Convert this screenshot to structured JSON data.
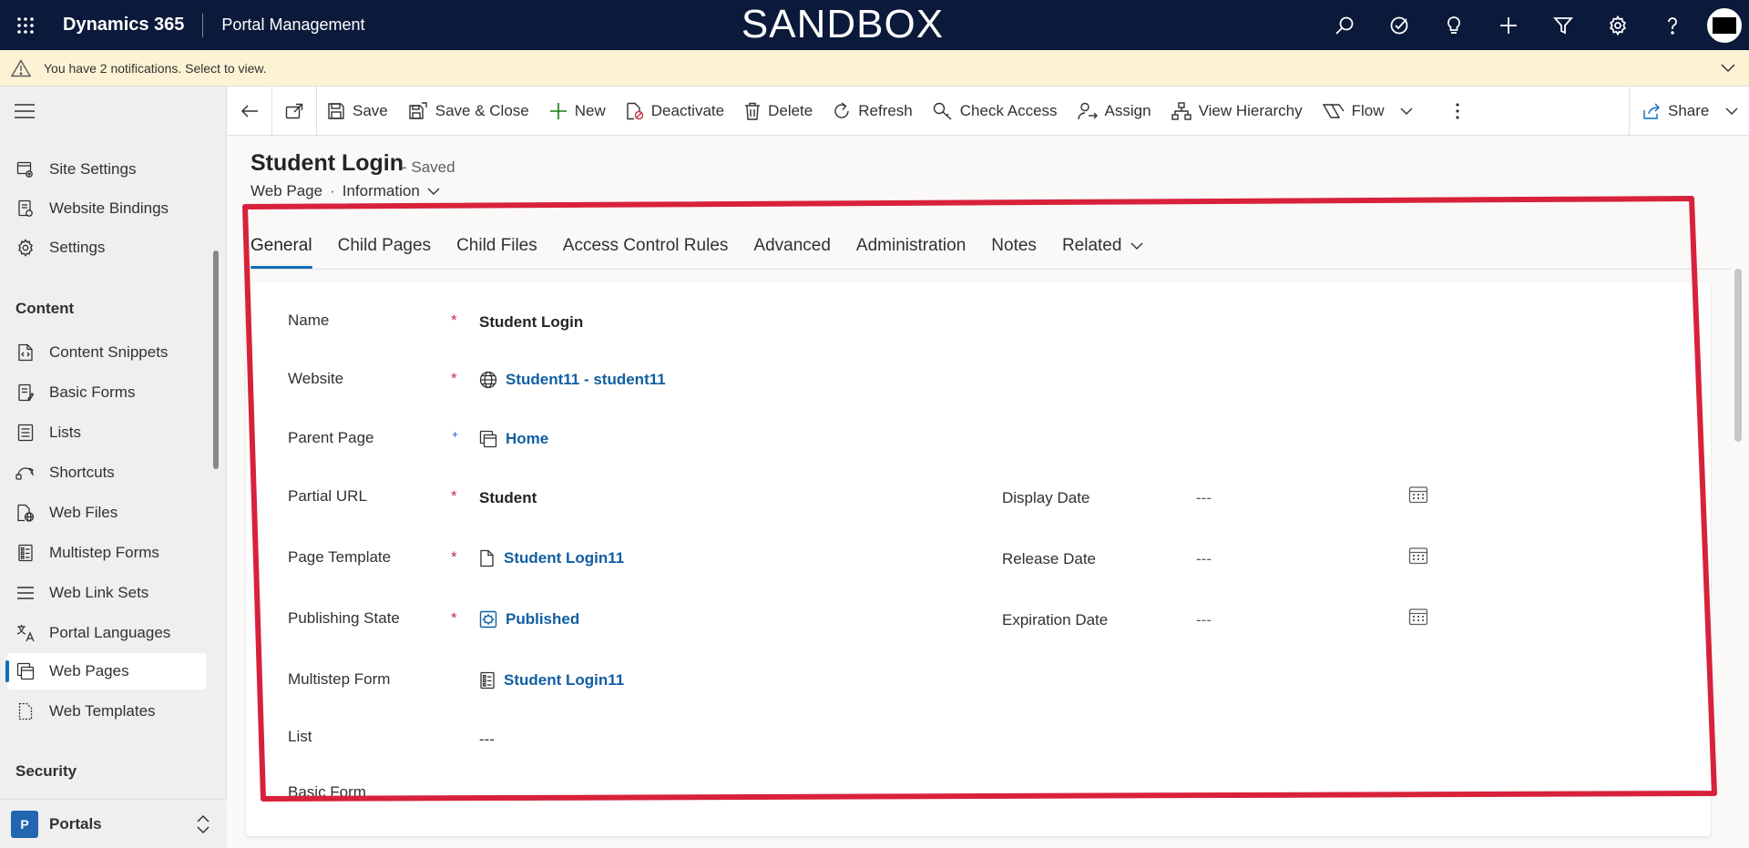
{
  "topbar": {
    "app_name": "Dynamics 365",
    "module_name": "Portal Management",
    "environment_label": "SANDBOX",
    "icons": [
      "search-icon",
      "task-check-icon",
      "lightbulb-icon",
      "plus-icon",
      "filter-icon",
      "gear-icon",
      "help-icon",
      "avatar"
    ]
  },
  "notification": {
    "text": "You have 2 notifications. Select to view."
  },
  "sidebar": {
    "items_top": [
      {
        "label": "Site Settings",
        "icon": "site-settings-icon"
      },
      {
        "label": "Website Bindings",
        "icon": "website-bindings-icon"
      },
      {
        "label": "Settings",
        "icon": "gear-icon"
      }
    ],
    "content_group": "Content",
    "content_items": [
      {
        "label": "Content Snippets",
        "icon": "snippet-icon"
      },
      {
        "label": "Basic Forms",
        "icon": "form-icon"
      },
      {
        "label": "Lists",
        "icon": "list-icon"
      },
      {
        "label": "Shortcuts",
        "icon": "shortcut-icon"
      },
      {
        "label": "Web Files",
        "icon": "web-file-icon"
      },
      {
        "label": "Multistep Forms",
        "icon": "multistep-form-icon"
      },
      {
        "label": "Web Link Sets",
        "icon": "link-set-icon"
      },
      {
        "label": "Portal Languages",
        "icon": "language-icon"
      },
      {
        "label": "Web Pages",
        "icon": "web-page-icon",
        "active": true
      },
      {
        "label": "Web Templates",
        "icon": "template-icon"
      }
    ],
    "security_group": "Security",
    "area": {
      "badge": "P",
      "name": "Portals"
    }
  },
  "commandbar": {
    "save": "Save",
    "save_close": "Save & Close",
    "new": "New",
    "deactivate": "Deactivate",
    "delete": "Delete",
    "refresh": "Refresh",
    "check_access": "Check Access",
    "assign": "Assign",
    "view_hierarchy": "View Hierarchy",
    "flow": "Flow",
    "share": "Share"
  },
  "record": {
    "title": "Student Login",
    "status": "- Saved",
    "entity": "Web Page",
    "separator": "·",
    "form_name": "Information"
  },
  "tabs": [
    "General",
    "Child Pages",
    "Child Files",
    "Access Control Rules",
    "Advanced",
    "Administration",
    "Notes",
    "Related"
  ],
  "form": {
    "required_mark": "*",
    "recommended_mark": "+",
    "name": {
      "label": "Name",
      "value": "Student Login"
    },
    "website": {
      "label": "Website",
      "value": "Student11 - student11"
    },
    "parent_page": {
      "label": "Parent Page",
      "value": "Home"
    },
    "partial_url": {
      "label": "Partial URL",
      "value": "Student"
    },
    "page_template": {
      "label": "Page Template",
      "value": "Student Login11"
    },
    "publishing_state": {
      "label": "Publishing State",
      "value": "Published"
    },
    "multistep_form": {
      "label": "Multistep Form",
      "value": "Student Login11"
    },
    "list": {
      "label": "List",
      "value": "---"
    },
    "basic_form": {
      "label": "Basic Form"
    },
    "display_date": {
      "label": "Display Date",
      "value": "---"
    },
    "release_date": {
      "label": "Release Date",
      "value": "---"
    },
    "expiration_date": {
      "label": "Expiration Date",
      "value": "---"
    }
  },
  "colors": {
    "topbar_bg": "#0b1a3a",
    "notification_bg": "#fcf3d5",
    "link": "#115ea3",
    "accent": "#0f6cbd",
    "required": "#c4314b",
    "highlight": "#d8213b"
  }
}
